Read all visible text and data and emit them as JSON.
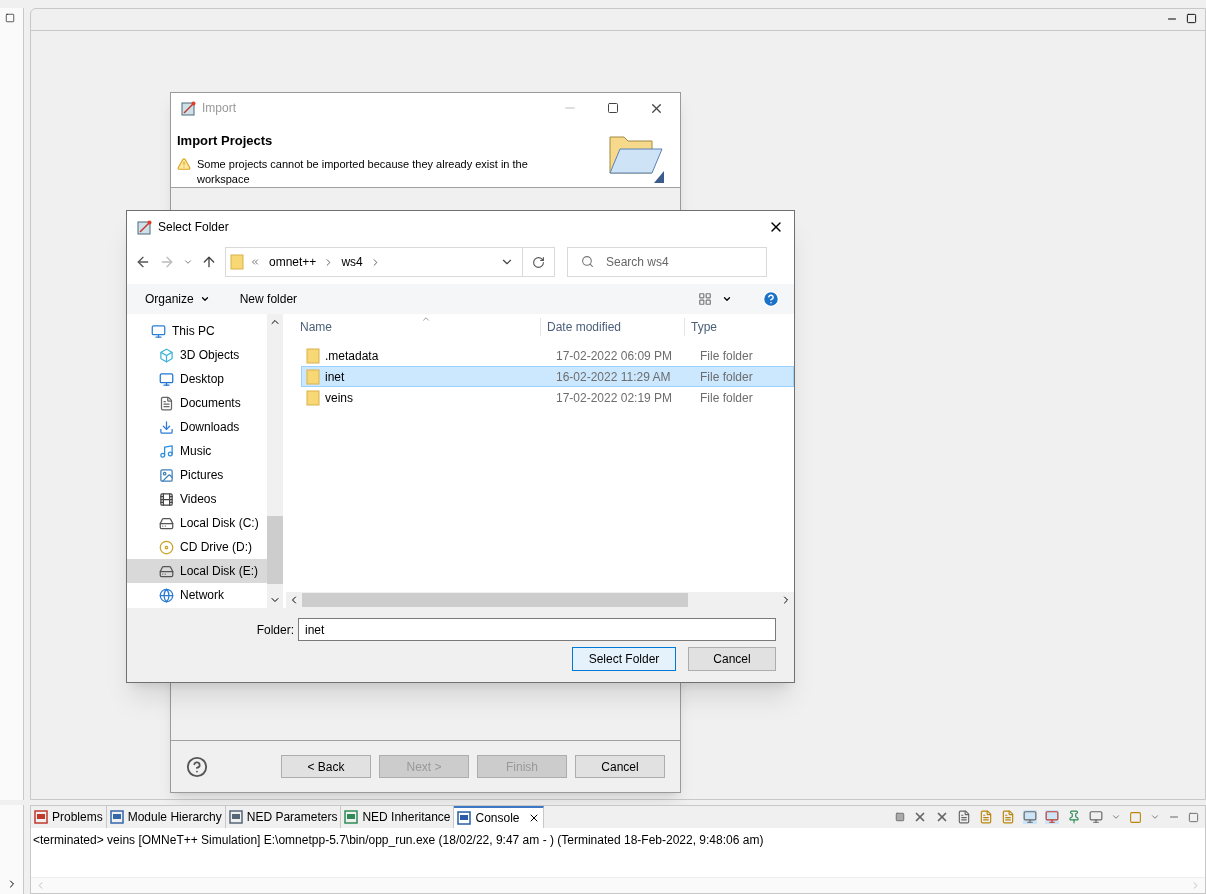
{
  "import_dialog": {
    "title": "Import",
    "heading": "Import Projects",
    "warning": "Some projects cannot be imported because they already exist in the workspace",
    "buttons": [
      {
        "label": "< Back",
        "disabled": false
      },
      {
        "label": "Next >",
        "disabled": true
      },
      {
        "label": "Finish",
        "disabled": true
      },
      {
        "label": "Cancel",
        "disabled": false
      }
    ]
  },
  "select_folder": {
    "title": "Select Folder",
    "breadcrumb": [
      "omnet++",
      "ws4"
    ],
    "search_placeholder": "Search ws4",
    "toolbar": [
      "Organize",
      "New folder"
    ],
    "nav_items": [
      {
        "label": "This PC",
        "kind": "pc",
        "selected": false
      },
      {
        "label": "3D Objects",
        "kind": "cube",
        "selected": false
      },
      {
        "label": "Desktop",
        "kind": "desktop",
        "selected": false
      },
      {
        "label": "Documents",
        "kind": "document",
        "selected": false
      },
      {
        "label": "Downloads",
        "kind": "download",
        "selected": false
      },
      {
        "label": "Music",
        "kind": "music",
        "selected": false
      },
      {
        "label": "Pictures",
        "kind": "picture",
        "selected": false
      },
      {
        "label": "Videos",
        "kind": "video",
        "selected": false
      },
      {
        "label": "Local Disk (C:)",
        "kind": "disk",
        "selected": false
      },
      {
        "label": "CD Drive (D:)",
        "kind": "cd",
        "selected": false
      },
      {
        "label": "Local Disk (E:)",
        "kind": "disk",
        "selected": true
      },
      {
        "label": "Network",
        "kind": "network",
        "selected": false
      }
    ],
    "columns": [
      "Name",
      "Date modified",
      "Type"
    ],
    "rows": [
      {
        "name": ".metadata",
        "date": "17-02-2022 06:09 PM",
        "type": "File folder",
        "selected": false
      },
      {
        "name": "inet",
        "date": "16-02-2022 11:29 AM",
        "type": "File folder",
        "selected": true
      },
      {
        "name": "veins",
        "date": "17-02-2022 02:19 PM",
        "type": "File folder",
        "selected": false
      }
    ],
    "folder_label": "Folder:",
    "folder_value": "inet",
    "buttons": [
      "Select Folder",
      "Cancel"
    ]
  },
  "bottom_panel": {
    "tabs": [
      {
        "label": "Problems",
        "selected": false
      },
      {
        "label": "Module Hierarchy",
        "selected": false
      },
      {
        "label": "NED Parameters",
        "selected": false
      },
      {
        "label": "NED Inheritance",
        "selected": false
      },
      {
        "label": "Console",
        "selected": true
      }
    ],
    "console_line": "<terminated> veins [OMNeT++ Simulation] E:\\omnetpp-5.7\\bin/opp_run.exe (18/02/22, 9:47 am - ) (Terminated 18-Feb-2022, 9:48:06 am)"
  }
}
